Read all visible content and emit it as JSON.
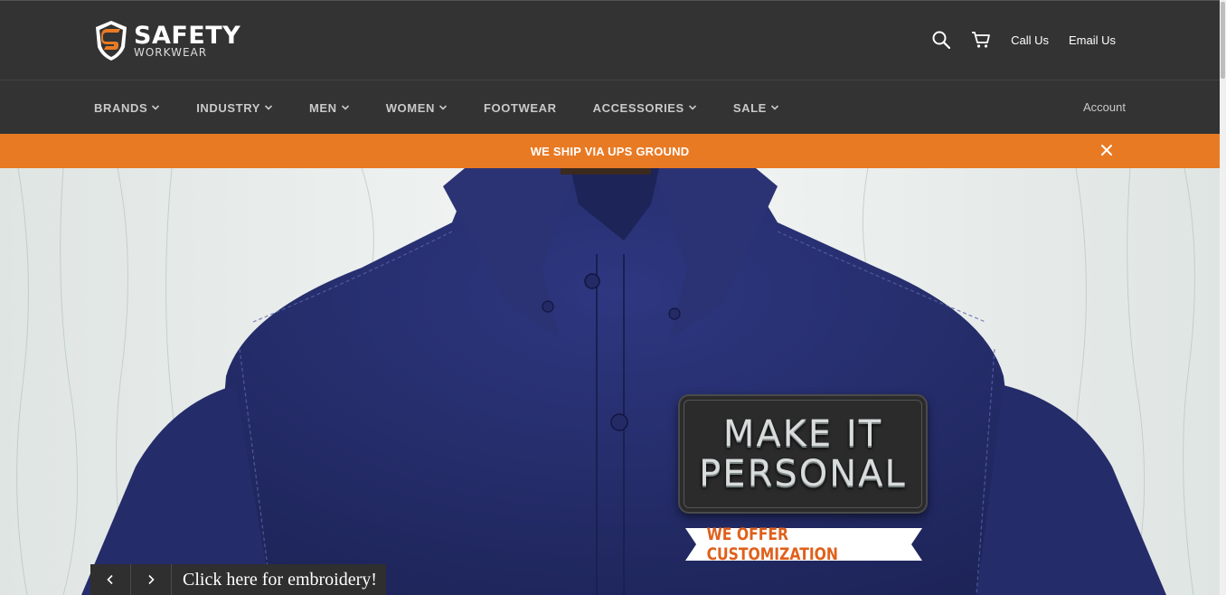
{
  "brand": {
    "line1": "SAFETY",
    "line2": "WORKWEAR"
  },
  "header": {
    "search_icon": "search-icon",
    "cart_icon": "cart-icon",
    "call_us": "Call Us",
    "email_us": "Email Us"
  },
  "nav": {
    "items": [
      {
        "label": "BRANDS",
        "dropdown": true
      },
      {
        "label": "INDUSTRY",
        "dropdown": true
      },
      {
        "label": "MEN",
        "dropdown": true
      },
      {
        "label": "WOMEN",
        "dropdown": true
      },
      {
        "label": "FOOTWEAR",
        "dropdown": false
      },
      {
        "label": "ACCESSORIES",
        "dropdown": true
      },
      {
        "label": "SALE",
        "dropdown": true
      }
    ],
    "account": "Account"
  },
  "promo": {
    "text": "WE SHIP VIA UPS GROUND",
    "close_icon": "close-icon"
  },
  "hero": {
    "patch_line1": "MAKE IT",
    "patch_line2": "PERSONAL",
    "ribbon": "WE OFFER CUSTOMIZATION",
    "caption": "Click here for embroidery!",
    "prev_icon": "chevron-left-icon",
    "next_icon": "chevron-right-icon"
  },
  "colors": {
    "header_bg": "#333333",
    "promo_bg": "#e97a24",
    "shirt": "#2a3272",
    "accent_orange": "#e0601b"
  }
}
